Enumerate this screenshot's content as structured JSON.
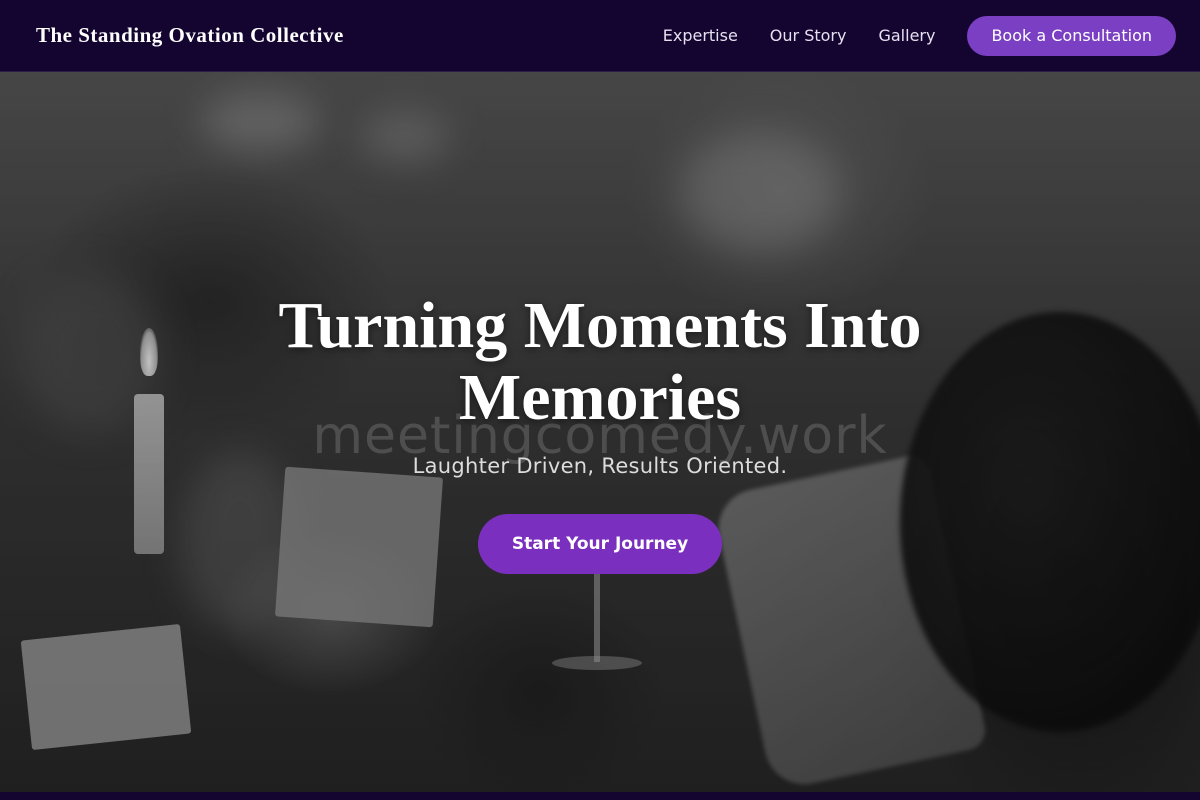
{
  "header": {
    "brand": "The Standing Ovation Collective",
    "nav": [
      {
        "label": "Expertise"
      },
      {
        "label": "Our Story"
      },
      {
        "label": "Gallery"
      }
    ],
    "cta_label": "Book a Consultation"
  },
  "hero": {
    "title": "Turning Moments Into Memories",
    "watermark": "meetingcomedy.work",
    "subtitle": "Laughter Driven, Results Oriented.",
    "button_label": "Start Your Journey"
  },
  "colors": {
    "navbar_bg": "#140530",
    "accent": "#7b3fc4",
    "hero_button": "#7b2fbe",
    "text": "#ffffff"
  }
}
